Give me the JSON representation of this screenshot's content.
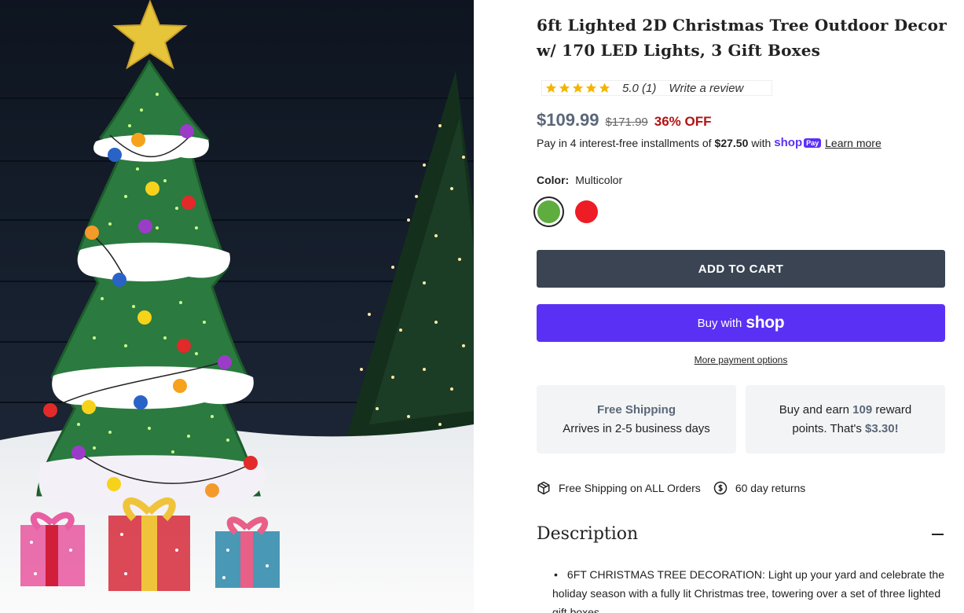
{
  "product": {
    "title": "6ft Lighted 2D Christmas Tree Outdoor Decor w/ 170 LED Lights, 3 Gift Boxes",
    "image_alt": "Lighted 2D Christmas tree with three gift boxes in snow"
  },
  "rating": {
    "stars": 5,
    "score_text": "5.0 (1)",
    "write_review": "Write a review",
    "star_color": "#f4b400"
  },
  "pricing": {
    "price": "$109.99",
    "compare_price": "$171.99",
    "discount": "36% OFF",
    "installments_prefix": "Pay in 4 interest-free installments of",
    "installment_amount": "$27.50",
    "installments_with": "with",
    "shop_word": "shop",
    "pay_badge": "Pay",
    "learn_more": "Learn more"
  },
  "variant": {
    "color_label": "Color:",
    "color_value": "Multicolor",
    "swatches": [
      {
        "name": "Green",
        "color": "#5fad3e",
        "selected": true
      },
      {
        "name": "Red",
        "color": "#ee1c25",
        "selected": false
      }
    ]
  },
  "actions": {
    "add_to_cart": "ADD TO CART",
    "buy_with": "Buy with",
    "buy_with_logo": "shop",
    "more_payment": "More payment options"
  },
  "cards": {
    "shipping_title": "Free Shipping",
    "shipping_sub": "Arrives in 2-5 business days",
    "rewards_pre": "Buy and earn",
    "rewards_points": "109",
    "rewards_mid": "reward",
    "rewards_line2_pre": "points. That's",
    "rewards_value": "$3.30!"
  },
  "perks": {
    "shipping": "Free Shipping on ALL Orders",
    "returns": "60 day returns"
  },
  "description": {
    "heading": "Description",
    "bullets": [
      "6FT CHRISTMAS TREE DECORATION: Light up your yard and celebrate the holiday season with a fully lit Christmas tree, towering over a set of three lighted gift boxes"
    ]
  },
  "colors": {
    "button_dark": "#3a4453",
    "shop_purple": "#5a31f4",
    "discount_red": "#b31212",
    "price_slate": "#5b6778"
  }
}
